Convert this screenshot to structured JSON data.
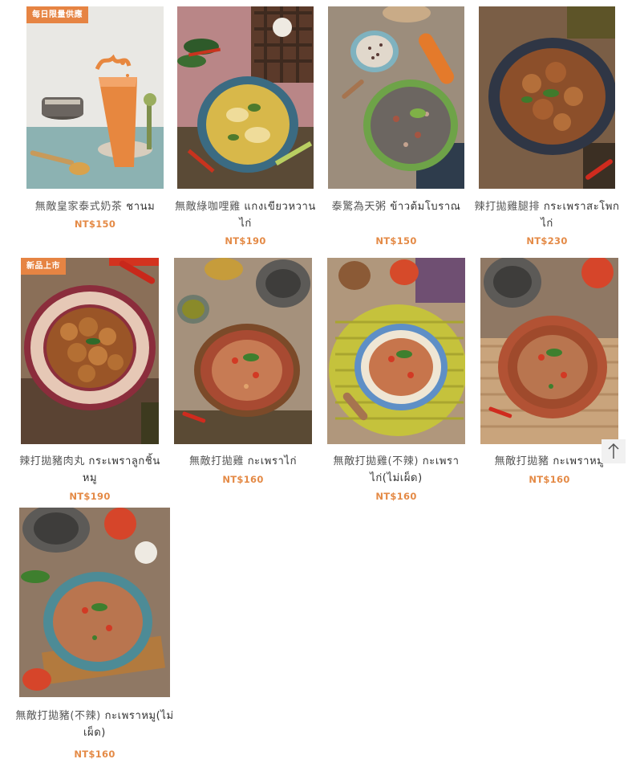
{
  "products": [
    {
      "zh": "無敵皇家泰式奶茶",
      "th": "ชานม",
      "price": "NT$150",
      "badge": "每日限量供應"
    },
    {
      "zh": "無敵綠咖哩雞",
      "th": "แกงเขียวหวานไก่",
      "price": "NT$190"
    },
    {
      "zh": "泰驚為天粥",
      "th": "ข้าวต้มโบราณ",
      "price": "NT$150"
    },
    {
      "zh": "辣打拋雞腿排",
      "th": "กระเพราสะโพกไก่",
      "price": "NT$230"
    },
    {
      "zh": "辣打拋豬肉丸",
      "th": "กระเพราลูกชิ้นหมู",
      "price": "NT$190",
      "badge": "新品上市"
    },
    {
      "zh": "無敵打拋雞",
      "th": "กะเพราไก่",
      "price": "NT$160"
    },
    {
      "zh": "無敵打拋雞(不辣)",
      "th": "กะเพราไก่(ไม่เผ็ด)",
      "price": "NT$160"
    },
    {
      "zh": "無敵打拋豬",
      "th": "กะเพราหมู",
      "price": "NT$160"
    },
    {
      "zh": "無敵打拋豬(不辣)",
      "th": "กะเพราหมู(ไม่เผ็ด)",
      "price": "NT$160"
    }
  ],
  "icons": {
    "back_to_top": "arrow-up-icon"
  },
  "colors": {
    "badge": "#e68443",
    "price": "#e48a46"
  }
}
